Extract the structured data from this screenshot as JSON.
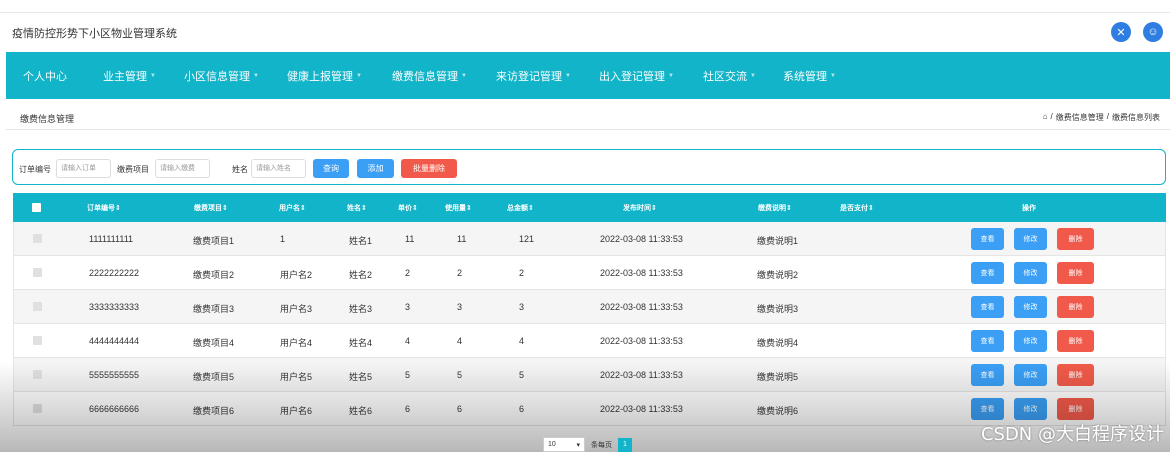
{
  "app": {
    "title": "疫情防控形势下小区物业管理系统"
  },
  "nav": [
    {
      "label": "个人中心",
      "caret": false
    },
    {
      "label": "业主管理",
      "caret": true
    },
    {
      "label": "小区信息管理",
      "caret": true
    },
    {
      "label": "健康上报管理",
      "caret": true
    },
    {
      "label": "缴费信息管理",
      "caret": true
    },
    {
      "label": "来访登记管理",
      "caret": true
    },
    {
      "label": "出入登记管理",
      "caret": true
    },
    {
      "label": "社区交流",
      "caret": true
    },
    {
      "label": "系统管理",
      "caret": true
    }
  ],
  "breadcrumb": {
    "page_title": "缴费信息管理",
    "path": [
      "缴费信息管理",
      "缴费信息列表"
    ]
  },
  "search": {
    "order_label": "订单编号",
    "order_placeholder": "请输入订单",
    "item_label": "缴费项目",
    "item_placeholder": "请输入缴费",
    "name_label": "姓名",
    "name_placeholder": "请输入姓名",
    "query_button": "查询",
    "add_button": "添加",
    "batch_delete_button": "批量删除"
  },
  "table": {
    "headers": [
      "订单编号",
      "缴费项目",
      "用户名",
      "姓名",
      "单价",
      "使用量",
      "总金额",
      "发布时间",
      "缴费说明",
      "是否支付",
      "操作"
    ],
    "rows": [
      {
        "order": "1111111111",
        "item": "缴费项目1",
        "user": "1",
        "name": "姓名1",
        "price": "11",
        "usage": "11",
        "total": "121",
        "time": "2022-03-08 11:33:53",
        "desc": "缴费说明1",
        "paid": ""
      },
      {
        "order": "2222222222",
        "item": "缴费项目2",
        "user": "用户名2",
        "name": "姓名2",
        "price": "2",
        "usage": "2",
        "total": "2",
        "time": "2022-03-08 11:33:53",
        "desc": "缴费说明2",
        "paid": ""
      },
      {
        "order": "3333333333",
        "item": "缴费项目3",
        "user": "用户名3",
        "name": "姓名3",
        "price": "3",
        "usage": "3",
        "total": "3",
        "time": "2022-03-08 11:33:53",
        "desc": "缴费说明3",
        "paid": ""
      },
      {
        "order": "4444444444",
        "item": "缴费项目4",
        "user": "用户名4",
        "name": "姓名4",
        "price": "4",
        "usage": "4",
        "total": "4",
        "time": "2022-03-08 11:33:53",
        "desc": "缴费说明4",
        "paid": ""
      },
      {
        "order": "5555555555",
        "item": "缴费项目5",
        "user": "用户名5",
        "name": "姓名5",
        "price": "5",
        "usage": "5",
        "total": "5",
        "time": "2022-03-08 11:33:53",
        "desc": "缴费说明5",
        "paid": ""
      },
      {
        "order": "6666666666",
        "item": "缴费项目6",
        "user": "用户名6",
        "name": "姓名6",
        "price": "6",
        "usage": "6",
        "total": "6",
        "time": "2022-03-08 11:33:53",
        "desc": "缴费说明6",
        "paid": ""
      }
    ],
    "actions": {
      "view": "查看",
      "edit": "修改",
      "delete": "删除"
    }
  },
  "pager": {
    "page_size": "10",
    "per_page_label": "条每页",
    "current_page": "1"
  },
  "watermark": "CSDN @大白程序设计",
  "colors": {
    "primary": "#11b4c8",
    "button_blue": "#3a9ff5",
    "button_red": "#f15a4a"
  },
  "icons": {
    "top_left": "shuffle-icon",
    "top_right": "user-icon",
    "home": "home-icon",
    "caret": "chevron-down-icon"
  }
}
